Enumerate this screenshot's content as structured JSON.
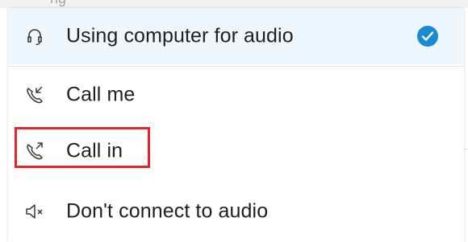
{
  "header": {
    "partial_text": "ng"
  },
  "menu": {
    "items": [
      {
        "label": "Using computer for audio",
        "icon": "headset-icon",
        "selected": true
      },
      {
        "label": "Call me",
        "icon": "phone-incoming-icon",
        "selected": false
      },
      {
        "label": "Call in",
        "icon": "phone-outgoing-icon",
        "selected": false
      },
      {
        "label": "Don't connect to audio",
        "icon": "speaker-mute-icon",
        "selected": false
      }
    ]
  },
  "colors": {
    "selected_row_bg": "#eef7fd",
    "check_blue": "#1a8bd0",
    "highlight_red": "#e3242b",
    "text": "#1f1f1f",
    "icon_stroke": "#3a3a3a"
  }
}
